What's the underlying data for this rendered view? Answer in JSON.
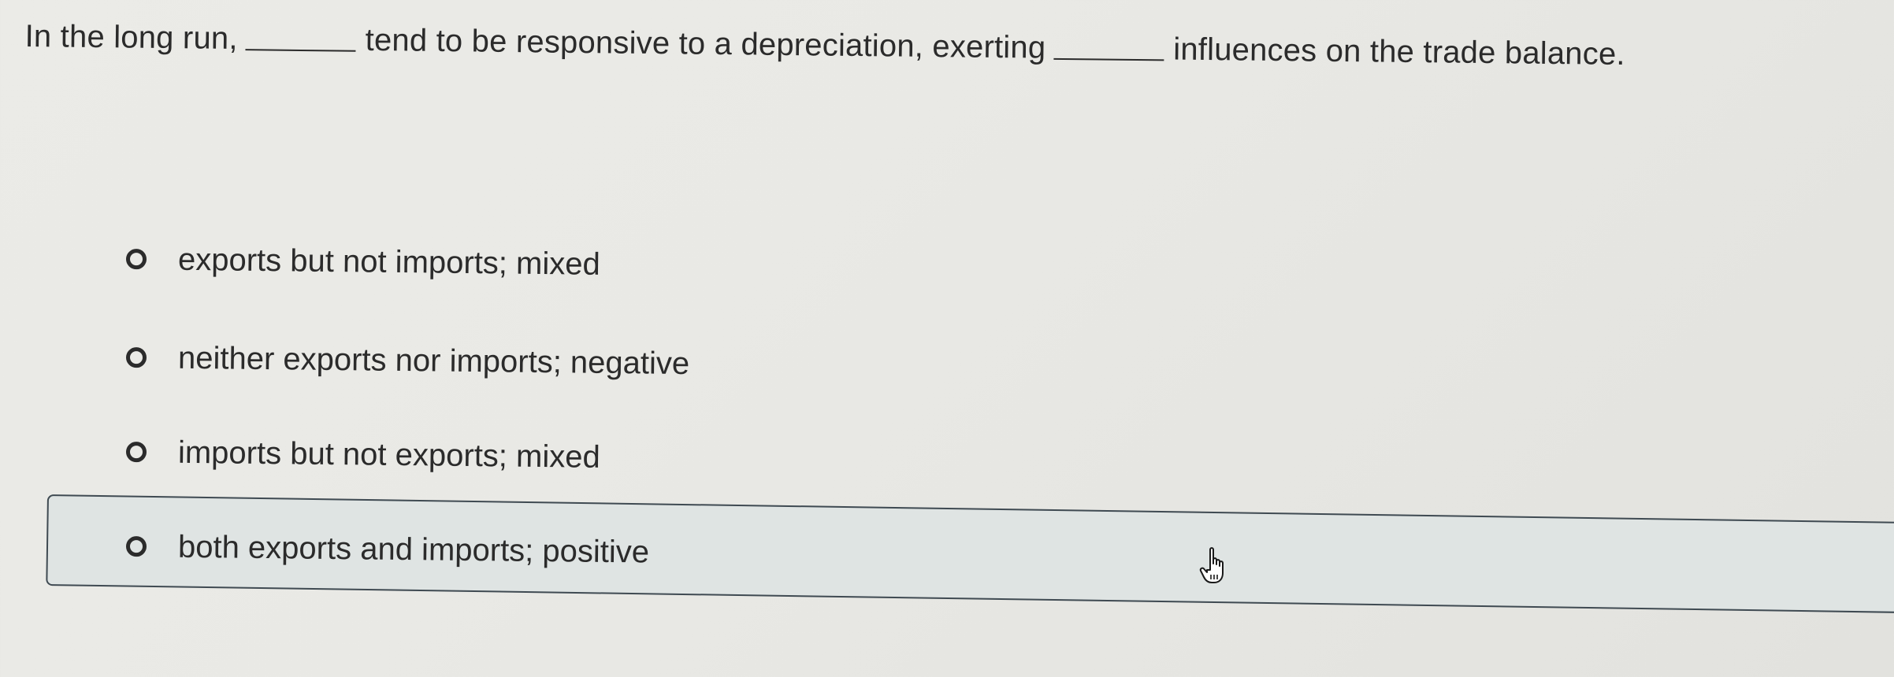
{
  "question": {
    "part1": "In the long run,",
    "part2": "tend to be responsive to a depreciation, exerting",
    "part3": "influences on the trade balance."
  },
  "options": [
    {
      "label": "exports but not imports; mixed"
    },
    {
      "label": "neither exports nor imports; negative"
    },
    {
      "label": "imports but not exports; mixed"
    },
    {
      "label": "both exports and imports; positive",
      "hovered": true
    }
  ],
  "cursor": {
    "icon": "hand-pointer-icon"
  },
  "colors": {
    "text": "#2b2b2b",
    "background": "#e9e9e5",
    "hover_background": "#dfe4e3",
    "hover_border": "#3f4a52"
  }
}
